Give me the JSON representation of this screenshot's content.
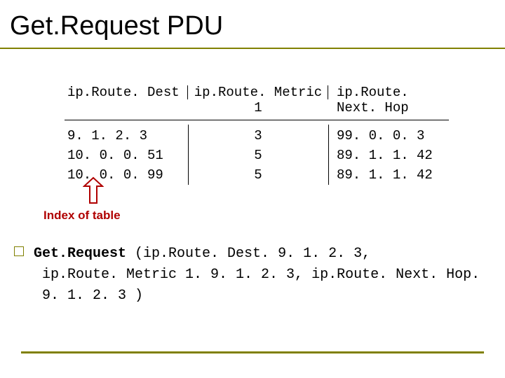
{
  "title": "Get.Request PDU",
  "table": {
    "headers": [
      "ip.Route. Dest",
      "ip.Route. Metric 1",
      "ip.Route. Next. Hop"
    ],
    "rows": [
      {
        "dest": "9. 1. 2. 3",
        "metric": "3",
        "nexthop": "99. 0. 0. 3"
      },
      {
        "dest": "10. 0. 0. 51",
        "metric": " 5",
        "nexthop": " 89. 1. 1. 42"
      },
      {
        "dest": "10. 0. 0. 99",
        "metric": "5",
        "nexthop": "89. 1. 1. 42"
      }
    ]
  },
  "index_caption": "Index of table",
  "request": {
    "prefix": "Get.Request ",
    "args_line1": "(ip.Route. Dest. 9. 1. 2. 3,",
    "args_line2": "ip.Route. Metric 1. 9. 1. 2. 3, ip.Route. Next. Hop. 9. 1. 2. 3 )"
  }
}
